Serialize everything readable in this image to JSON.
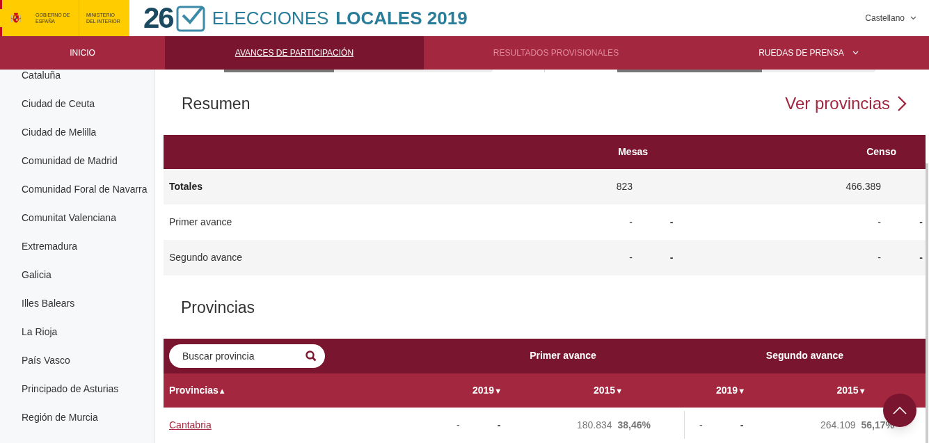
{
  "header": {
    "logo_lines": [
      "GOBIERNO DE ESPAÑA",
      "MINISTERIO DEL INTERIOR"
    ],
    "day": "26",
    "title_light": "ELECCIONES",
    "title_bold": "LOCALES 2019",
    "language": "Castellano"
  },
  "nav": [
    {
      "label": "INICIO",
      "selected": false,
      "disabled": false,
      "dropdown": false
    },
    {
      "label": "AVANCES DE PARTICIPACIÓN",
      "selected": true,
      "disabled": false,
      "dropdown": false
    },
    {
      "label": "RESULTADOS PROVISIONALES",
      "selected": false,
      "disabled": true,
      "dropdown": false
    },
    {
      "label": "RUEDAS DE PRENSA",
      "selected": false,
      "disabled": false,
      "dropdown": true
    }
  ],
  "sidebar": {
    "items": [
      "Cataluña",
      "Ciudad de Ceuta",
      "Ciudad de Melilla",
      "Comunidad de Madrid",
      "Comunidad Foral de Navarra",
      "Comunitat Valenciana",
      "Extremadura",
      "Galicia",
      "Illes Balears",
      "La Rioja",
      "País Vasco",
      "Principado de Asturias",
      "Región de Murcia"
    ]
  },
  "progress_bars": [
    {
      "level": 0.41
    },
    {
      "level": 0.56
    }
  ],
  "resumen": {
    "title": "Resumen",
    "link": "Ver provincias",
    "columns": [
      "Mesas",
      "",
      "Censo"
    ],
    "rows": [
      {
        "label": "Totales",
        "bold": true,
        "cells": [
          "823",
          "",
          "466.389",
          ""
        ]
      },
      {
        "label": "Primer avance",
        "bold": false,
        "cells": [
          "-",
          "-",
          "-",
          "-"
        ]
      },
      {
        "label": "Segundo avance",
        "bold": false,
        "cells": [
          "-",
          "-",
          "-",
          "-"
        ]
      }
    ]
  },
  "provincias": {
    "title": "Provincias",
    "search": {
      "placeholder": "Buscar provincia"
    },
    "groups": [
      "Primer avance",
      "Segundo avance"
    ],
    "columns": [
      {
        "label": "Provincias",
        "arrow": "▲"
      },
      {
        "label": "2019",
        "arrow": "▼"
      },
      {
        "label": "2015",
        "arrow": "▼"
      },
      {
        "label": "2019",
        "arrow": "▼"
      },
      {
        "label": "2015",
        "arrow": "▼"
      }
    ],
    "rows": [
      {
        "name": "Cantabria",
        "first": [
          "-",
          "-",
          "180.834",
          "38,46%"
        ],
        "second": [
          "-",
          "-",
          "264.109",
          "56,17%"
        ]
      }
    ]
  }
}
